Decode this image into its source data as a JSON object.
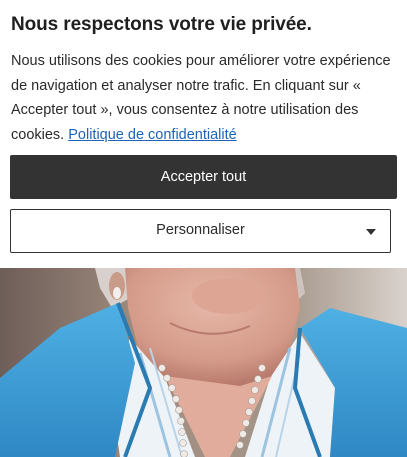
{
  "consent": {
    "title": "Nous respectons votre vie privée.",
    "body": "Nous utilisons des cookies pour améliorer votre expérience de navigation et analyser notre trafic. En cliquant sur « Accepter tout », vous consentez à notre utilisation des cookies.",
    "policy_link": "Politique de confidentialité",
    "accept_label": "Accepter tout",
    "customize_label": "Personnaliser",
    "customize_icon": "chevron-down-icon"
  },
  "colors": {
    "accept_bg": "#333333",
    "link": "#1d63b8",
    "jacket": "#3f9fd6"
  }
}
